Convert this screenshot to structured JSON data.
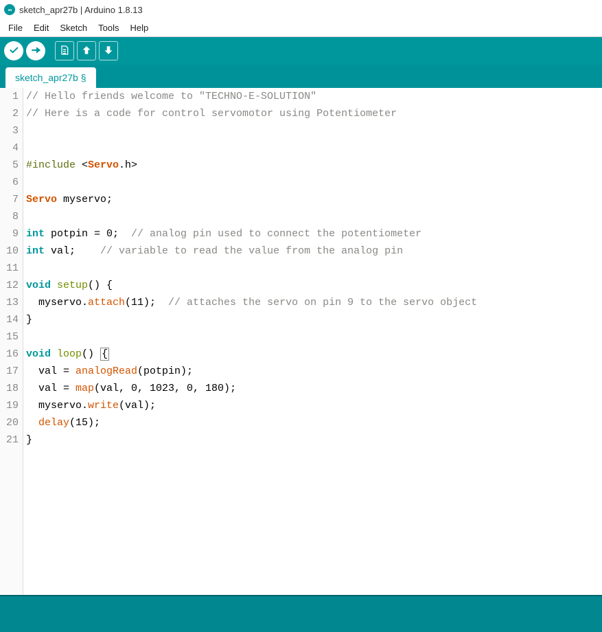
{
  "title_bar": {
    "icon_text": "∞",
    "text": "sketch_apr27b | Arduino 1.8.13"
  },
  "menu": {
    "file": "File",
    "edit": "Edit",
    "sketch": "Sketch",
    "tools": "Tools",
    "help": "Help"
  },
  "tab": {
    "label": "sketch_apr27b §"
  },
  "code": {
    "lines": [
      {
        "n": "1",
        "tokens": [
          {
            "cls": "tok-comment",
            "t": "// Hello friends welcome to \"TECHNO-E-SOLUTION\""
          }
        ]
      },
      {
        "n": "2",
        "tokens": [
          {
            "cls": "tok-comment",
            "t": "// Here is a code for control servomotor using Potentiometer"
          }
        ]
      },
      {
        "n": "3",
        "tokens": []
      },
      {
        "n": "4",
        "tokens": []
      },
      {
        "n": "5",
        "tokens": [
          {
            "cls": "tok-preproc",
            "t": "#include"
          },
          {
            "cls": "",
            "t": " <"
          },
          {
            "cls": "tok-struct",
            "t": "Servo"
          },
          {
            "cls": "",
            "t": ".h>"
          }
        ]
      },
      {
        "n": "6",
        "tokens": []
      },
      {
        "n": "7",
        "tokens": [
          {
            "cls": "tok-struct",
            "t": "Servo"
          },
          {
            "cls": "",
            "t": " myservo;"
          }
        ]
      },
      {
        "n": "8",
        "tokens": []
      },
      {
        "n": "9",
        "tokens": [
          {
            "cls": "tok-type",
            "t": "int"
          },
          {
            "cls": "",
            "t": " potpin = 0;  "
          },
          {
            "cls": "tok-comment",
            "t": "// analog pin used to connect the potentiometer"
          }
        ]
      },
      {
        "n": "10",
        "tokens": [
          {
            "cls": "tok-type",
            "t": "int"
          },
          {
            "cls": "",
            "t": " val;    "
          },
          {
            "cls": "tok-comment",
            "t": "// variable to read the value from the analog pin"
          }
        ]
      },
      {
        "n": "11",
        "tokens": []
      },
      {
        "n": "12",
        "tokens": [
          {
            "cls": "tok-type",
            "t": "void"
          },
          {
            "cls": "",
            "t": " "
          },
          {
            "cls": "tok-kw",
            "t": "setup"
          },
          {
            "cls": "",
            "t": "() {"
          }
        ]
      },
      {
        "n": "13",
        "tokens": [
          {
            "cls": "",
            "t": "  myservo."
          },
          {
            "cls": "tok-func",
            "t": "attach"
          },
          {
            "cls": "",
            "t": "(11);  "
          },
          {
            "cls": "tok-comment",
            "t": "// attaches the servo on pin 9 to the servo object"
          }
        ]
      },
      {
        "n": "14",
        "tokens": [
          {
            "cls": "",
            "t": "}"
          }
        ]
      },
      {
        "n": "15",
        "tokens": []
      },
      {
        "n": "16",
        "tokens": [
          {
            "cls": "tok-type",
            "t": "void"
          },
          {
            "cls": "",
            "t": " "
          },
          {
            "cls": "tok-kw",
            "t": "loop"
          },
          {
            "cls": "",
            "t": "() "
          },
          {
            "cls": "box",
            "t": "{"
          }
        ]
      },
      {
        "n": "17",
        "tokens": [
          {
            "cls": "",
            "t": "  val = "
          },
          {
            "cls": "tok-func",
            "t": "analogRead"
          },
          {
            "cls": "",
            "t": "(potpin);"
          }
        ]
      },
      {
        "n": "18",
        "tokens": [
          {
            "cls": "",
            "t": "  val = "
          },
          {
            "cls": "tok-func",
            "t": "map"
          },
          {
            "cls": "",
            "t": "(val, 0, 1023, 0, 180);"
          }
        ]
      },
      {
        "n": "19",
        "tokens": [
          {
            "cls": "",
            "t": "  myservo."
          },
          {
            "cls": "tok-func",
            "t": "write"
          },
          {
            "cls": "",
            "t": "(val);"
          }
        ]
      },
      {
        "n": "20",
        "tokens": [
          {
            "cls": "",
            "t": "  "
          },
          {
            "cls": "tok-func",
            "t": "delay"
          },
          {
            "cls": "",
            "t": "(15);"
          }
        ]
      },
      {
        "n": "21",
        "tokens": [
          {
            "cls": "",
            "t": "}"
          }
        ]
      }
    ]
  }
}
